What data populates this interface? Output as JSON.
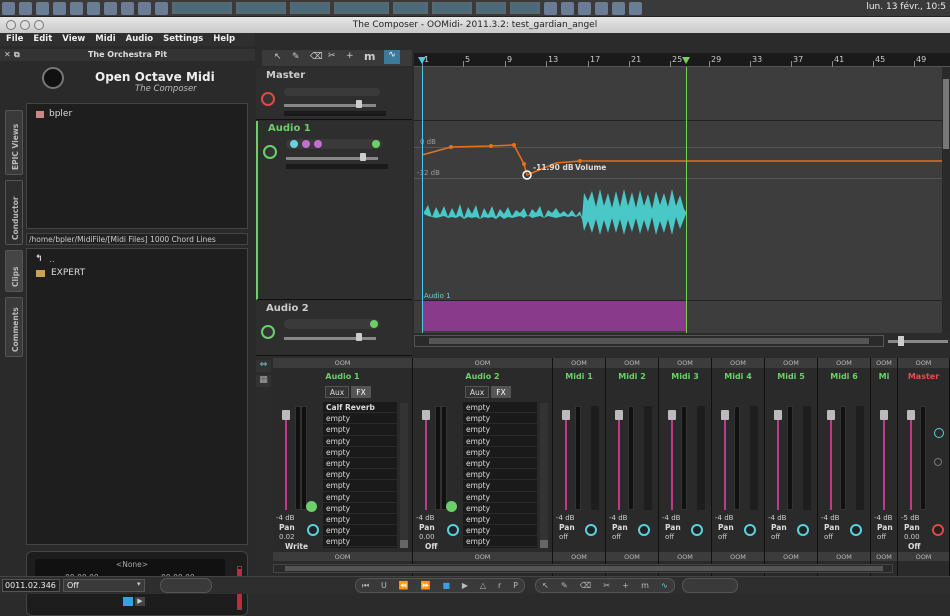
{
  "taskbar": {
    "clock": "lun. 13 févr., 10:5"
  },
  "window": {
    "title": "The Composer - OOMidi- 2011.3.2: test_gardian_angel"
  },
  "menu": [
    "File",
    "Edit",
    "View",
    "Midi",
    "Audio",
    "Settings",
    "Help"
  ],
  "sidebar": {
    "header": "The Orchestra Pit",
    "logo_line1": "Open Octave Midi",
    "logo_line2": "The Composer",
    "tree_item": "bpler",
    "path": "/home/bpler/MidiFile/[Midi Files] 1000 Chord Lines",
    "up_item": "..",
    "folder_item": "EXPERT",
    "vtabs": [
      "EPIC Views",
      "Conductor",
      "Clips",
      "Comments"
    ]
  },
  "transport": {
    "marker": "<None>",
    "time1": "00:00:00",
    "time2": "00:00:00"
  },
  "bottom": {
    "position": "0011.02.346",
    "mode": "Off"
  },
  "ruler": {
    "ticks": [
      "1",
      "5",
      "9",
      "13",
      "17",
      "21",
      "25",
      "29",
      "33",
      "37",
      "41",
      "45",
      "49"
    ]
  },
  "arranger_toolbar": {
    "m_label": "m"
  },
  "tracks": [
    {
      "name": "Master",
      "color": "#cccccc"
    },
    {
      "name": "Audio 1",
      "color": "#6ad06a"
    },
    {
      "name": "Audio 2",
      "color": "#cccccc"
    }
  ],
  "automation": {
    "label_0db": "0 dB",
    "label_32db": "-32 dB",
    "value": "-11.90 dB",
    "param": "Volume",
    "part_label": "Audio 1"
  },
  "mixer": {
    "oom_label": "OOM",
    "strips": [
      {
        "name": "Audio 1",
        "db": "-4 dB",
        "pan_label": "Pan",
        "pan_val": "0.02",
        "mode": "Write"
      },
      {
        "name": "Audio 2",
        "db": "-4 dB",
        "pan_label": "Pan",
        "pan_val": "0.00",
        "mode": "Off"
      },
      {
        "name": "Midi 1",
        "db": "-4 dB",
        "pan_label": "Pan",
        "pan_val": "off"
      },
      {
        "name": "Midi 2",
        "db": "-4 dB",
        "pan_label": "Pan",
        "pan_val": "off"
      },
      {
        "name": "Midi 3",
        "db": "-4 dB",
        "pan_label": "Pan",
        "pan_val": "off"
      },
      {
        "name": "Midi 4",
        "db": "-4 dB",
        "pan_label": "Pan",
        "pan_val": "off"
      },
      {
        "name": "Midi 5",
        "db": "-4 dB",
        "pan_label": "Pan",
        "pan_val": "off"
      },
      {
        "name": "Midi 6",
        "db": "-4 dB",
        "pan_label": "Pan",
        "pan_val": "off"
      },
      {
        "name": "Mi",
        "db": "-4 dB",
        "pan_label": "Pan",
        "pan_val": "off"
      },
      {
        "name": "Master",
        "db": "-5 dB",
        "pan_label": "Pan",
        "pan_val": "0.00",
        "mode": "Off"
      }
    ],
    "aux_label": "Aux",
    "fx_label": "FX",
    "fx1": [
      "Calf Reverb",
      "empty",
      "empty",
      "empty",
      "empty",
      "empty",
      "empty",
      "empty",
      "empty",
      "empty",
      "empty",
      "empty",
      "empty"
    ],
    "fx2": [
      "empty",
      "empty",
      "empty",
      "empty",
      "empty",
      "empty",
      "empty",
      "empty",
      "empty",
      "empty",
      "empty",
      "empty",
      "empty"
    ]
  },
  "colors": {
    "accent_green": "#6ad06a",
    "automation_orange": "#e8701a",
    "waveform": "#4ac8c8",
    "part_magenta": "#8a3a8a",
    "fader_pink": "#c03a8a"
  }
}
